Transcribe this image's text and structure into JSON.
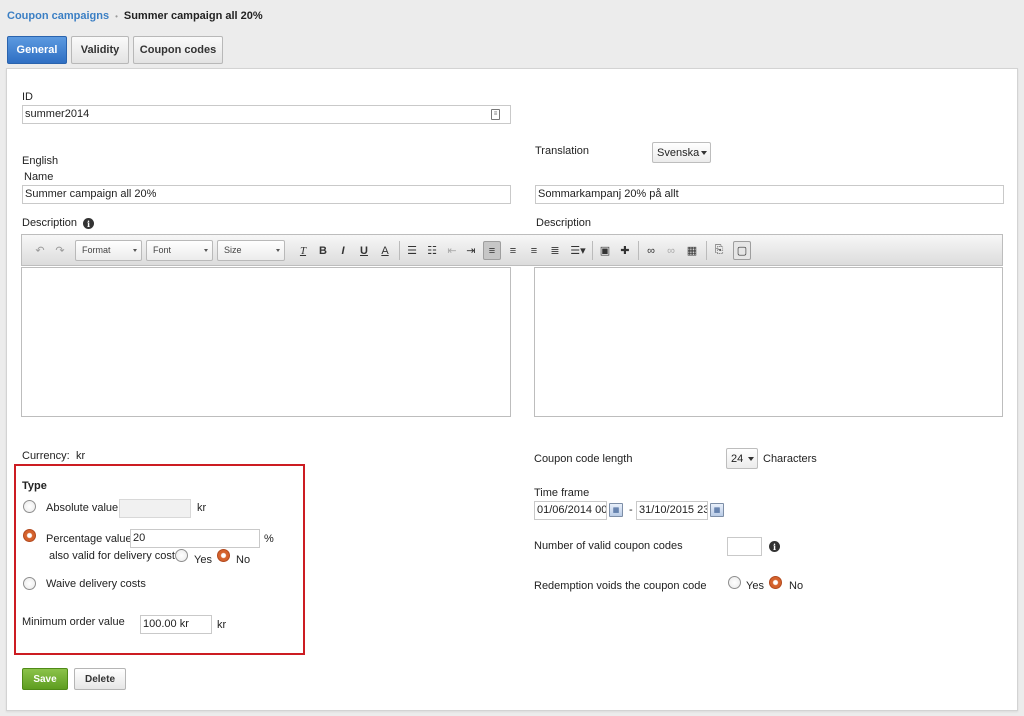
{
  "breadcrumb": {
    "parent": "Coupon campaigns",
    "separator": "•",
    "current": "Summer campaign all 20%"
  },
  "tabs": [
    {
      "label": "General"
    },
    {
      "label": "Validity"
    },
    {
      "label": "Coupon codes"
    }
  ],
  "id_field": {
    "label": "ID",
    "value": "summer2014"
  },
  "translation": {
    "label": "Translation",
    "selected": "Svenska"
  },
  "english": {
    "section_label": "English",
    "name_label": "Name",
    "name_value": "Summer campaign all 20%",
    "description_label": "Description"
  },
  "swedish": {
    "name_value": "Sommarkampanj 20% på allt",
    "description_label": "Description"
  },
  "editor": {
    "format_label": "Format",
    "font_label": "Font",
    "size_label": "Size",
    "bold": "B",
    "italic": "I",
    "underline": "U",
    "font_color": "A",
    "clear_format": "T",
    "undo_icon": "undo-icon",
    "redo_icon": "redo-icon"
  },
  "currency": {
    "label": "Currency:",
    "value": "kr"
  },
  "type_section": {
    "title": "Type",
    "absolute_label": "Absolute value",
    "absolute_value": "",
    "absolute_unit": "kr",
    "percentage_label": "Percentage value",
    "percentage_value": "20",
    "percentage_unit": "%",
    "delivery_label": "also valid for delivery costs",
    "delivery_yes": "Yes",
    "delivery_no": "No",
    "waive_label": "Waive delivery costs",
    "selected": "percentage",
    "delivery_selected": "no"
  },
  "min_order": {
    "label": "Minimum order value",
    "value": "100.00 kr",
    "unit": "kr"
  },
  "coupon_code_length": {
    "label": "Coupon code length",
    "value": "24",
    "unit": "Characters"
  },
  "time_frame": {
    "label": "Time frame",
    "from": "01/06/2014 00:",
    "separator": "-",
    "to": "31/10/2015 23"
  },
  "valid_codes": {
    "label": "Number of valid coupon codes",
    "value": ""
  },
  "redemption": {
    "label": "Redemption voids the coupon code",
    "yes": "Yes",
    "no": "No",
    "selected": "no"
  },
  "actions": {
    "save": "Save",
    "delete": "Delete"
  },
  "colors": {
    "accent": "#3b7fc4",
    "save_green": "#6aac2a",
    "highlight_red": "#cc1c22",
    "radio_orange": "#d5622c"
  }
}
